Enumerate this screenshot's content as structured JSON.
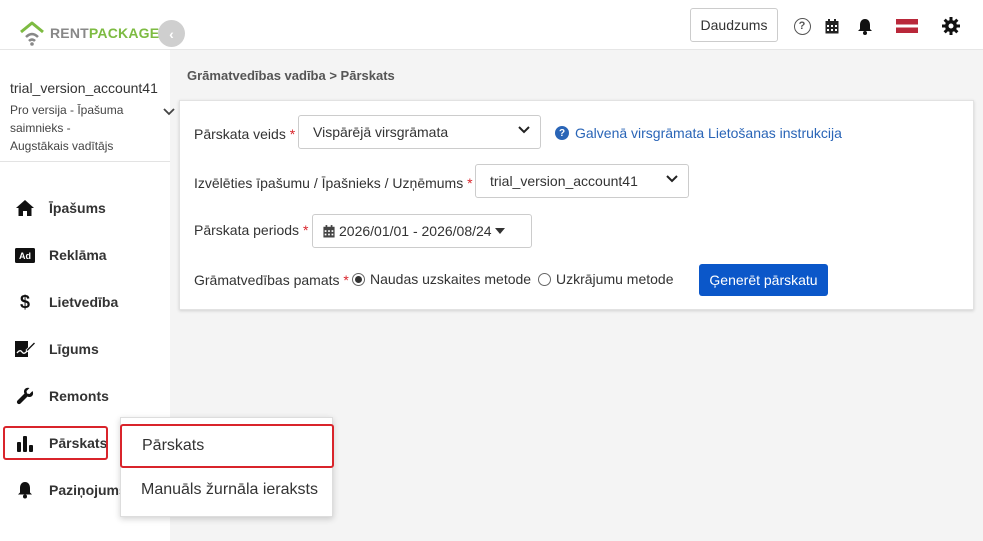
{
  "header": {
    "logo_part1": "RENT",
    "logo_part2": "PACKAGE",
    "collapse_glyph": "‹",
    "quantity_button": "Daudzums",
    "help_glyph": "?",
    "colors": {
      "brand_green": "#7dbb42",
      "accent_red": "#d9242b",
      "primary_blue": "#0b57c9"
    }
  },
  "sidebar": {
    "account_name": "trial_version_account41",
    "account_role": "Pro versija - Īpašuma saimnieks - Augstākais vadītājs",
    "items": [
      {
        "label": "Īpašums",
        "icon": "home-icon"
      },
      {
        "label": "Reklāma",
        "icon": "ad-icon"
      },
      {
        "label": "Lietvedība",
        "icon": "dollar-icon"
      },
      {
        "label": "Līgums",
        "icon": "contract-icon"
      },
      {
        "label": "Remonts",
        "icon": "wrench-icon"
      },
      {
        "label": "Pārskats",
        "icon": "bar-chart-icon",
        "active": true
      },
      {
        "label": "Paziņojums",
        "icon": "bell-icon"
      }
    ]
  },
  "breadcrumb": "Grāmatvedības vadība > Pārskats",
  "form": {
    "report_type_label": "Pārskata veids",
    "report_type_value": "Vispārējā virsgrāmata",
    "help_link": "Galvenā virsgrāmata Lietošanas instrukcija",
    "entity_label": "Izvēlēties īpašumu / Īpašnieks / Uzņēmums",
    "entity_value": "trial_version_account41",
    "period_label": "Pārskata periods",
    "period_value": "2026/01/01 - 2026/08/24",
    "basis_label": "Grāmatvedības pamats",
    "basis_option_cash": "Naudas uzskaites metode",
    "basis_option_accrual": "Uzkrājumu metode",
    "basis_selected": "cash",
    "generate_button": "Ģenerēt pārskatu",
    "required_mark": "*"
  },
  "submenu": {
    "items": [
      {
        "label": "Pārskats",
        "active": true
      },
      {
        "label": "Manuāls žurnāla ieraksts"
      }
    ]
  }
}
